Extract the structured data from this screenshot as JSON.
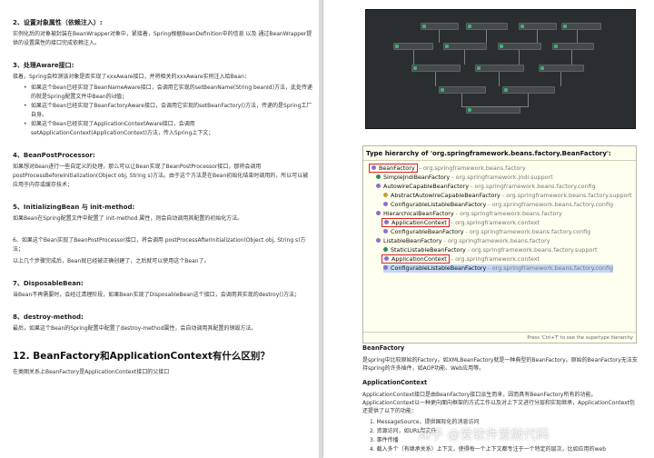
{
  "left": {
    "s2_heading": "2、设置对象属性（依赖注入）:",
    "s2_body": "实例化后的对象被封装在BeanWrapper对象中，紧接着，Spring根据BeanDefinition中的信息 以及 通过BeanWrapper提供的设置属性的接口完成依赖注入。",
    "s3_heading": "3、处理Aware接口:",
    "s3_intro": "接着，Spring会检测该对象是否实现了xxxAware接口，并将相关的xxxAware实例注入给Bean：",
    "s3_items": [
      "如果这个Bean已经实现了BeanNameAware接口，会调用它实现的setBeanName(String beanId)方法，此处传递的就是Spring配置文件中Bean的id值；",
      "如果这个Bean已经实现了BeanFactoryAware接口，会调用它实现的setBeanFactory()方法，传递的是Spring工厂自身。",
      "如果这个Bean已经实现了ApplicationContextAware接口，会调用 setApplicationContext(ApplicationContext)方法，传入Spring上下文；"
    ],
    "s4_heading": "4、BeanPostProcessor:",
    "s4_body": "如果想对Bean进行一些自定义的处理，那么可以让Bean实现了BeanPostProcessor接口，那将会调用postProcessBeforeInitialization(Object obj, String s)方法。由于这个方法是在Bean初始化结束时调用的，所以可以被应用于内存或缓存技术；",
    "s5_heading": "5、InitializingBean 与 init-method:",
    "s5_body": "如果Bean在Spring配置文件中配置了 init-method 属性，则会自动调用其配置的初始化方法。",
    "s6_body1": "6、如果这个Bean实现了BeanPostProcessor接口，将会调用 postProcessAfterInitialization(Object obj, String s)方法；",
    "s6_body2": "以上几个步骤完成后，Bean就已经被正确创建了，之后就可以使用这个Bean了。",
    "s7_heading": "7、DisposableBean:",
    "s7_body": "当Bean不再需要时，会经过清理阶段，如果Bean实现了DisposableBean这个接口，会调用其实现的destroy()方法；",
    "s8_heading": "8、destroy-method:",
    "s8_body": "最后，如果这个Bean的Spring配置中配置了destroy-method属性，会自动调用其配置的销毁方法。",
    "q12_heading": "12. BeanFactory和ApplicationContext有什么区别？",
    "q12_body": "在类图关系上BeanFactory是ApplicationContext接口的父接口"
  },
  "hierarchy": {
    "title": "Type hierarchy of 'org.springframework.beans.factory.BeanFactory':",
    "rows": [
      {
        "name": "BeanFactory",
        "pkg": " - org.springframework.beans.factory",
        "icon": "interface-icon",
        "boxed": true,
        "selected": false
      },
      {
        "name": "SimpleJndiBeanFactory",
        "pkg": " - org.springframework.jndi.support",
        "icon": "class-icon",
        "boxed": false,
        "selected": false
      },
      {
        "name": "AutowireCapableBeanFactory",
        "pkg": " - org.springframework.beans.factory.config",
        "icon": "interface-icon",
        "boxed": false,
        "selected": false
      },
      {
        "name": "AbstractAutowireCapableBeanFactory",
        "pkg": " - org.springframework.beans.factory.support",
        "icon": "abstract-class-icon",
        "boxed": false,
        "selected": false
      },
      {
        "name": "ConfigurableListableBeanFactory",
        "pkg": " - org.springframework.beans.factory.config",
        "icon": "interface-icon",
        "boxed": false,
        "selected": false
      },
      {
        "name": "HierarchicalBeanFactory",
        "pkg": " - org.springframework.beans.factory",
        "icon": "interface-icon",
        "boxed": false,
        "selected": false
      },
      {
        "name": "ApplicationContext",
        "pkg": " - org.springframework.context",
        "icon": "interface-icon",
        "boxed": true,
        "selected": false
      },
      {
        "name": "ConfigurableBeanFactory",
        "pkg": " - org.springframework.beans.factory.config",
        "icon": "interface-icon",
        "boxed": false,
        "selected": false
      },
      {
        "name": "ListableBeanFactory",
        "pkg": " - org.springframework.beans.factory",
        "icon": "interface-icon",
        "boxed": false,
        "selected": false
      },
      {
        "name": "StaticListableBeanFactory",
        "pkg": " - org.springframework.beans.factory.support",
        "icon": "class-icon",
        "boxed": false,
        "selected": false
      },
      {
        "name": "ApplicationContext",
        "pkg": " - org.springframework.context",
        "icon": "interface-icon",
        "boxed": true,
        "selected": false
      },
      {
        "name": "ConfigurableListableBeanFactory",
        "pkg": " - org.springframework.beans.factory.config",
        "icon": "interface-icon",
        "boxed": false,
        "selected": true
      }
    ],
    "footer": "Press 'Ctrl+T' to see the supertype hierarchy"
  },
  "right": {
    "bf_heading": "BeanFactory",
    "bf_body": "是spring中比较原始的Factory。如XMLBeanFactory就是一种典型的BeanFactory。原始的BeanFactory无法支持spring的许多插件，如AOP功能、Web应用等。",
    "ac_heading": "ApplicationContext",
    "ac_body": "ApplicationContext接口是由BeanFactory接口派生而来，因而具有BeanFactory所有的功能。ApplicationContext以一种更向面向框架的方式工作以及对上下文进行分层和实现继承，ApplicationContext包还提供了以下的功能：",
    "ac_items": [
      "1. MessageSource，提供国际化的消息访问",
      "2. 资源访问，如URL和文件",
      "3. 事件传播",
      "4. 载入多个（有继承关系）上下文，使得每一个上下文都专注于一个特定的层次，比如应用的web"
    ]
  },
  "watermark": "知乎 @爱软件爱敲代码"
}
